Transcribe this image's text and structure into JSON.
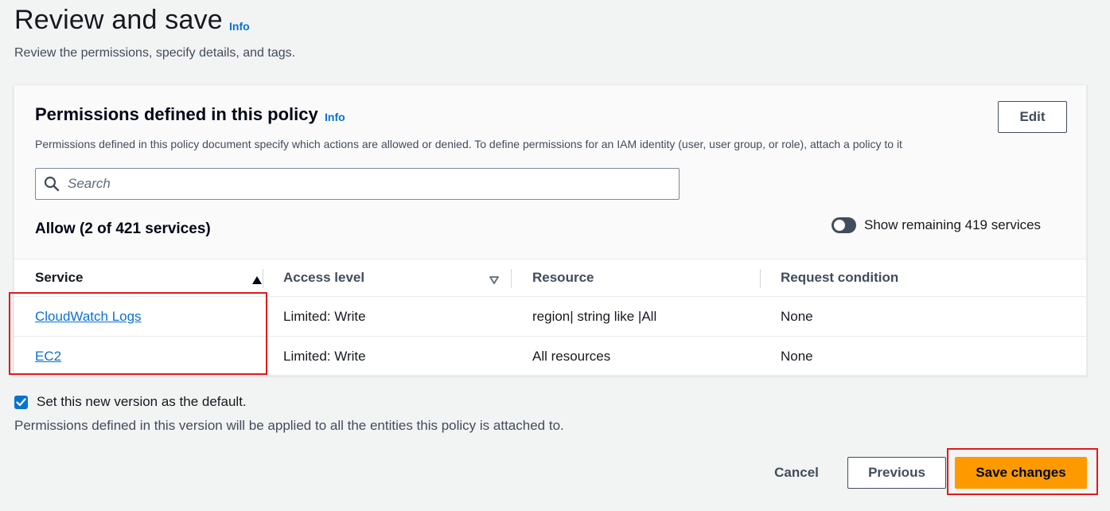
{
  "header": {
    "title": "Review and save",
    "info_label": "Info",
    "description": "Review the permissions, specify details, and tags."
  },
  "permissions_panel": {
    "title": "Permissions defined in this policy",
    "info_label": "Info",
    "description": "Permissions defined in this policy document specify which actions are allowed or denied. To define permissions for an IAM identity (user, user group, or role), attach a policy to it",
    "edit_label": "Edit",
    "search": {
      "placeholder": "Search",
      "value": ""
    },
    "allow_heading": "Allow (2 of 421 services)",
    "toggle": {
      "label": "Show remaining 419 services",
      "on": false
    },
    "table": {
      "columns": [
        "Service",
        "Access level",
        "Resource",
        "Request condition"
      ],
      "sorted_column": "Service",
      "sort_direction": "ascending",
      "rows": [
        {
          "service": "CloudWatch Logs",
          "access_level": "Limited: Write",
          "resource": "region| string like |All",
          "request_condition": "None"
        },
        {
          "service": "EC2",
          "access_level": "Limited: Write",
          "resource": "All resources",
          "request_condition": "None"
        }
      ]
    }
  },
  "default_version": {
    "checked": true,
    "label": "Set this new version as the default.",
    "note": "Permissions defined in this version will be applied to all the entities this policy is attached to."
  },
  "footer": {
    "cancel_label": "Cancel",
    "previous_label": "Previous",
    "save_label": "Save changes"
  },
  "colors": {
    "link": "#0972d3",
    "primary_button": "#ff9900",
    "highlight_annotation": "#e01b1b",
    "page_background": "#f2f3f3"
  }
}
